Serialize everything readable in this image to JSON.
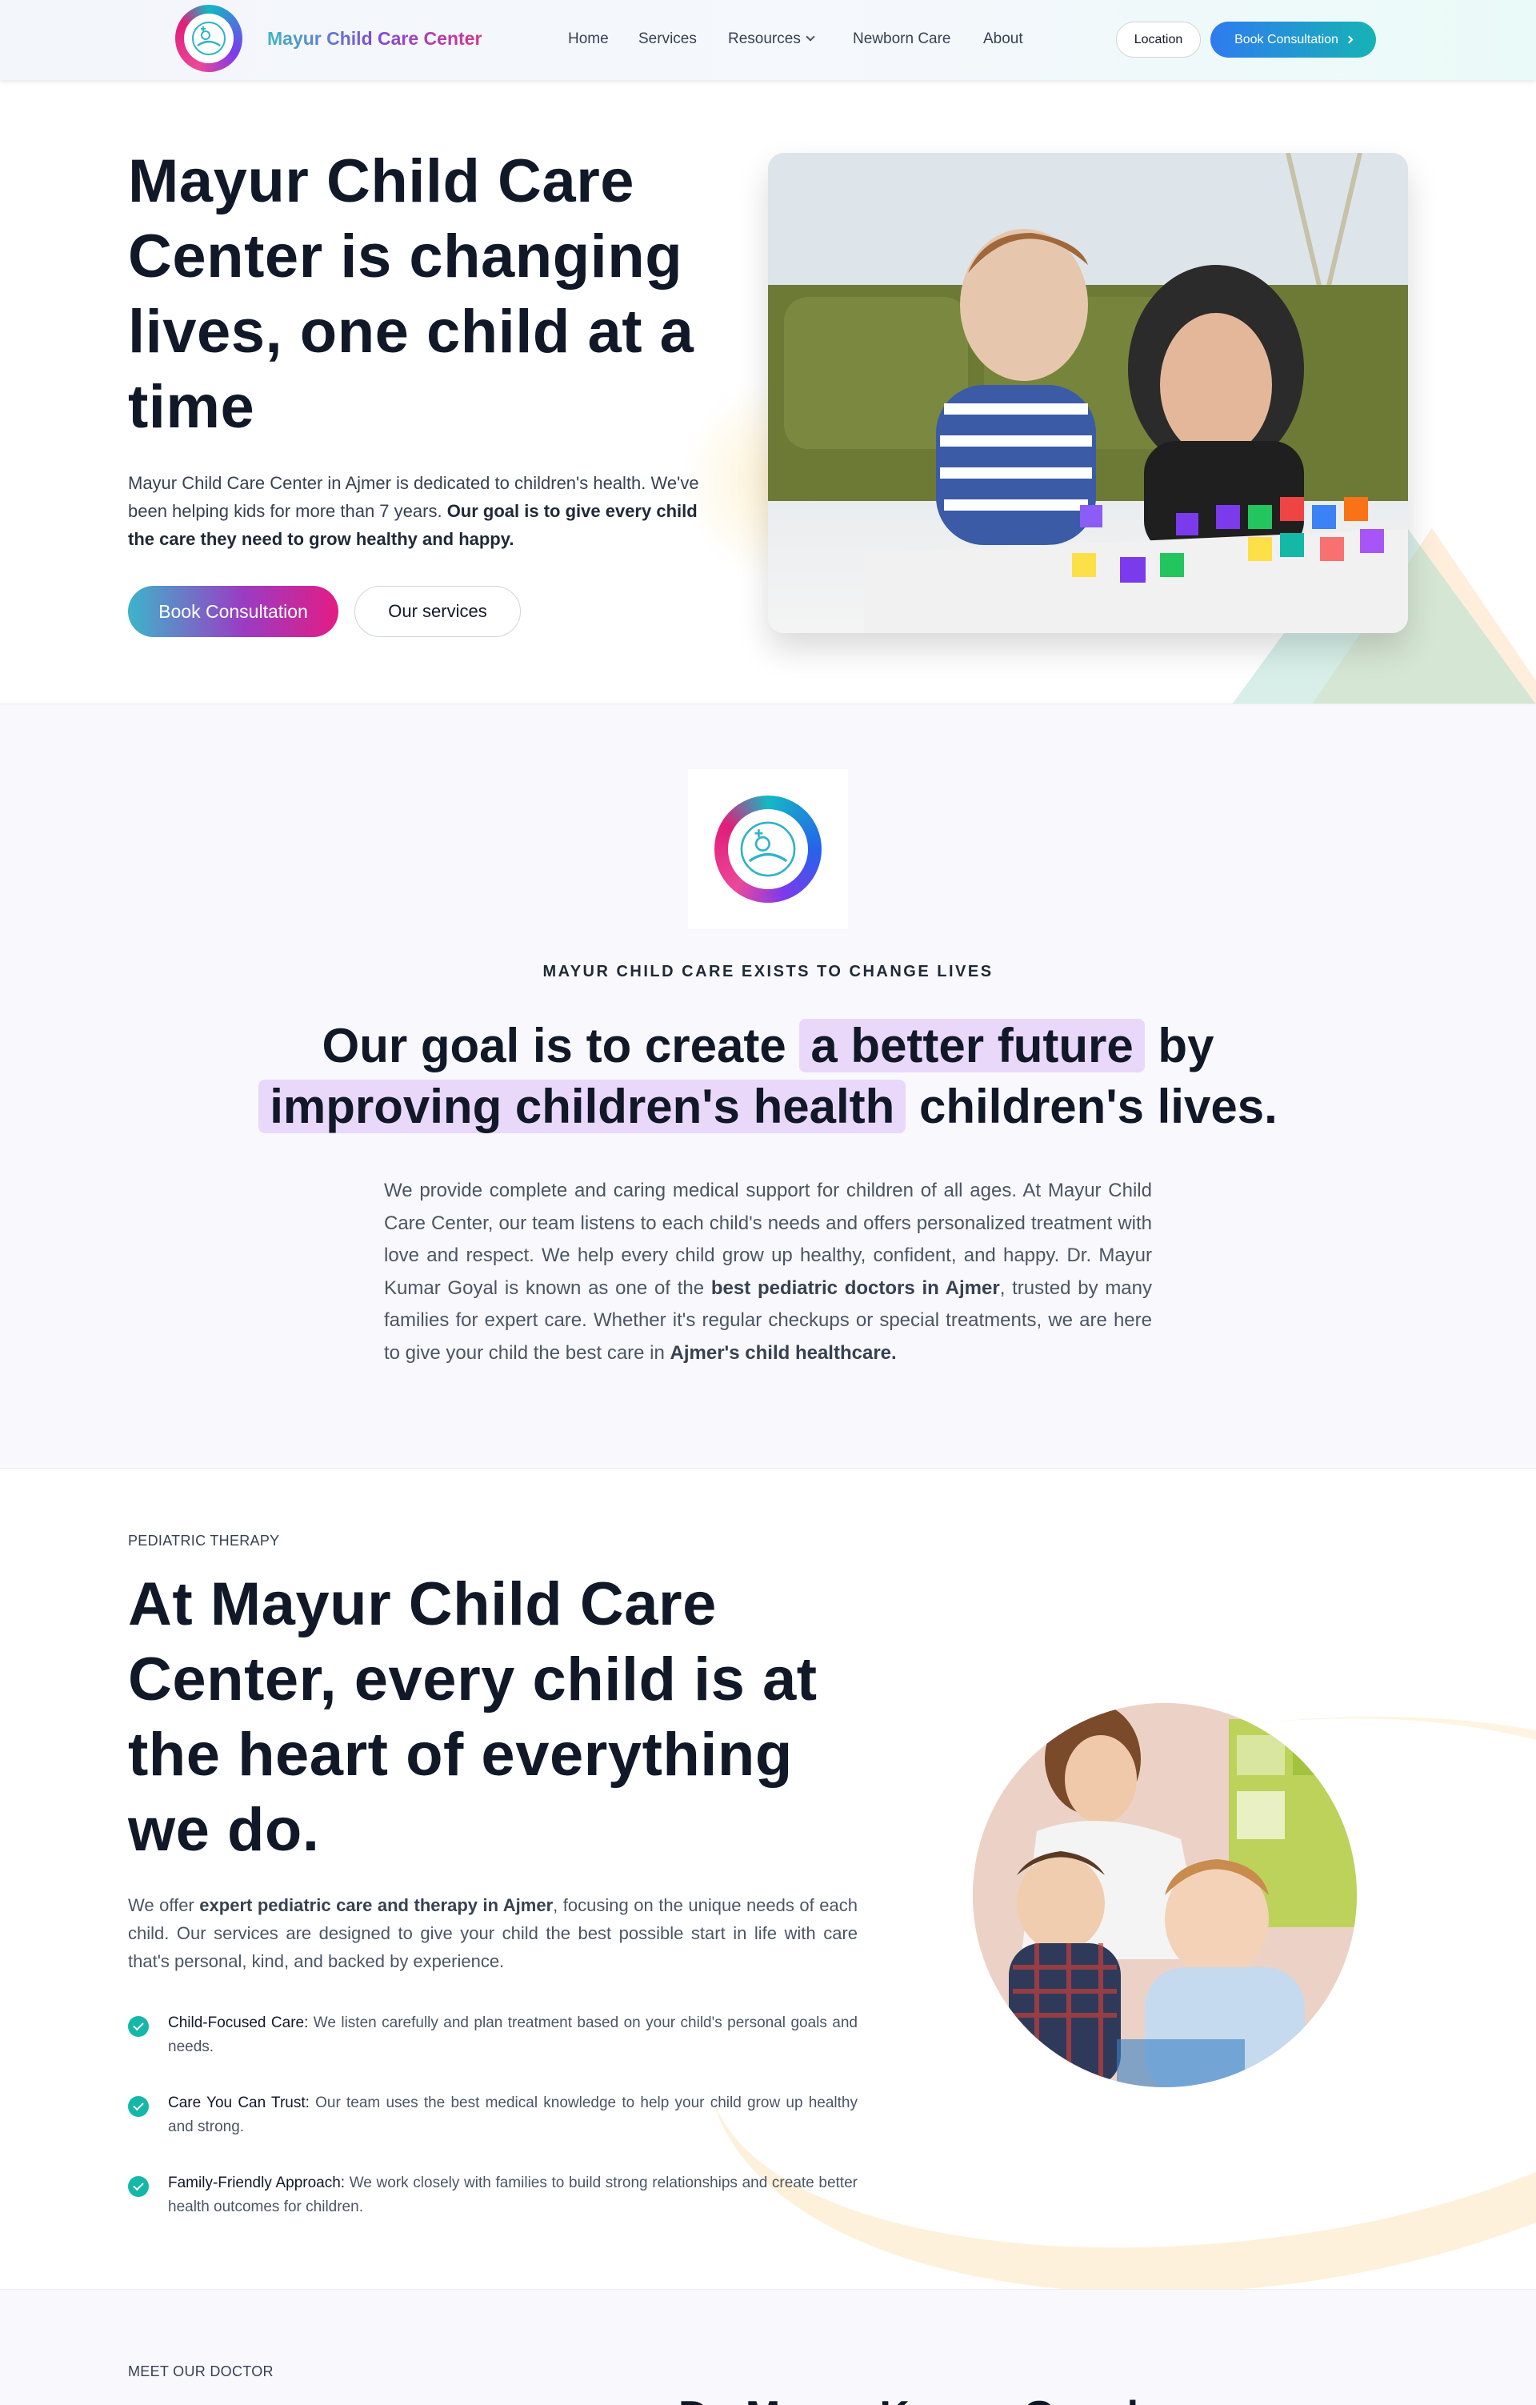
{
  "header": {
    "brand": "Mayur Child Care Center",
    "logo_icon": "mayur-logo-icon",
    "nav": {
      "home": "Home",
      "services": "Services",
      "resources": "Resources",
      "newborn": "Newborn Care",
      "about": "About"
    },
    "location_label": "Location",
    "book_label": "Book Consultation"
  },
  "hero": {
    "title": "Mayur Child Care Center is changing lives, one child at a time",
    "text_part1": "Mayur Child Care Center in Ajmer is dedicated to children's health. We've been helping kids for more than 7 years. ",
    "text_bold": "Our goal is to give every child the care they need to grow healthy and happy.",
    "book_label": "Book Consultation",
    "services_label": "Our services"
  },
  "mission": {
    "kicker": "MAYUR CHILD CARE EXISTS TO CHANGE LIVES",
    "heading_part1": "Our goal is to create ",
    "heading_highlight1": "a better future",
    "heading_part2": " by ",
    "heading_highlight2": "improving children's health",
    "heading_part3": " children's lives.",
    "body_part1": "We provide complete and caring medical support for children of all ages. At Mayur Child Care Center, our team listens to each child's needs and offers personalized treatment with love and respect. We help every child grow up healthy, confident, and happy. Dr. Mayur Kumar Goyal is known as one of the ",
    "body_bold1": "best pediatric doctors in Ajmer",
    "body_part2": ", trusted by many families for expert care. Whether it's regular checkups or special treatments, we are here to give your child the best care in ",
    "body_bold2": "Ajmer's child healthcare."
  },
  "therapy": {
    "kicker": "PEDIATRIC THERAPY",
    "title": "At Mayur Child Care Center, every child is at the heart of everything we do.",
    "text_part1": "We offer ",
    "text_bold": "expert pediatric care and therapy in Ajmer",
    "text_part2": ", focusing on the unique needs of each child. Our services are designed to give your child the best possible start in life with care that's personal, kind, and backed by experience.",
    "features": [
      {
        "title": "Child-Focused Care:",
        "text": " We listen carefully and plan treatment based on your child's personal goals and needs."
      },
      {
        "title": "Care You Can Trust:",
        "text": " Our team uses the best medical knowledge to help your child grow up healthy and strong."
      },
      {
        "title": "Family-Friendly Approach:",
        "text": " We work closely with families to build strong relationships and create better health outcomes for children."
      }
    ]
  },
  "doctor": {
    "kicker": "MEET OUR DOCTOR",
    "name": "Dr. Mayur Kumar Goyal"
  },
  "colors": {
    "accent_teal": "#14b8a6",
    "accent_pink": "#e31c84",
    "accent_purple": "#9a3cc3",
    "highlight": "#ead8fb",
    "book_blue": "#2f7bf0"
  }
}
